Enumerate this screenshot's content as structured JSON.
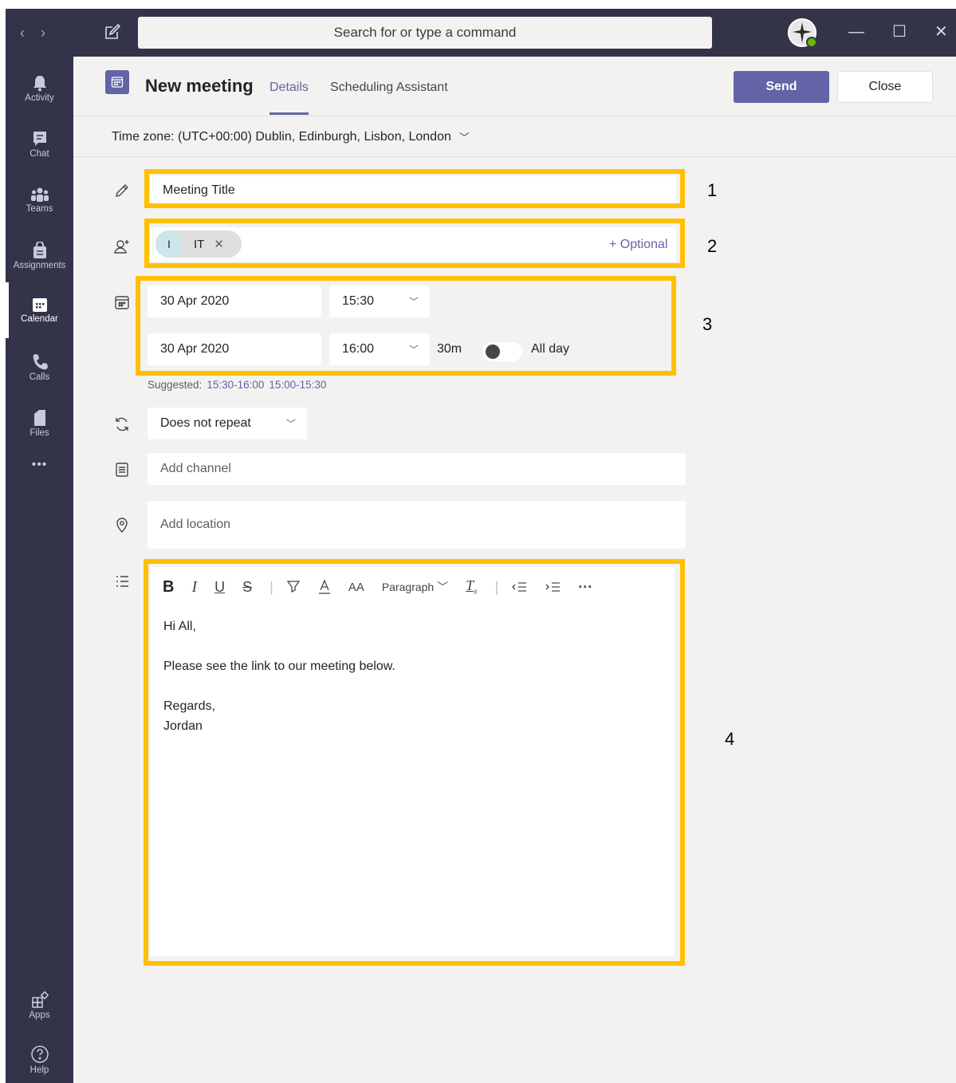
{
  "titlebar": {
    "back": "‹",
    "forward": "›",
    "search_placeholder": "Search for or type a command"
  },
  "appbar": [
    {
      "label": "Activity",
      "icon": "bell-icon"
    },
    {
      "label": "Chat",
      "icon": "chat-icon"
    },
    {
      "label": "Teams",
      "icon": "teams-icon"
    },
    {
      "label": "Assignments",
      "icon": "assignments-icon"
    },
    {
      "label": "Calendar",
      "icon": "calendar-icon"
    },
    {
      "label": "Calls",
      "icon": "phone-icon"
    },
    {
      "label": "Files",
      "icon": "file-icon"
    },
    {
      "label": "•••",
      "icon": "more-icon"
    }
  ],
  "appbar_bottom": [
    {
      "label": "Apps",
      "icon": "apps-icon"
    },
    {
      "label": "Help",
      "icon": "help-icon"
    }
  ],
  "header": {
    "title": "New meeting",
    "tabs": [
      "Details",
      "Scheduling Assistant"
    ],
    "send": "Send",
    "close": "Close"
  },
  "timezone": "Time zone: (UTC+00:00) Dublin, Edinburgh, Lisbon, London",
  "form": {
    "title_value": "Meeting Title",
    "attendee_initial": "I",
    "attendee_name": "IT",
    "optional": "+ Optional",
    "start_date": "30 Apr 2020",
    "start_time": "15:30",
    "end_date": "30 Apr 2020",
    "end_time": "16:00",
    "duration": "30m",
    "all_day": "All day",
    "suggested_label": "Suggested:",
    "suggested": [
      "15:30-16:00",
      "15:00-15:30"
    ],
    "repeat": "Does not repeat",
    "channel_placeholder": "Add channel",
    "location_placeholder": "Add location"
  },
  "editor": {
    "toolbar": {
      "bold": "B",
      "italic": "I",
      "underline": "U",
      "strike": "S",
      "font_size": "AA",
      "paragraph": "Paragraph",
      "clear": "T"
    },
    "lines": [
      "Hi All,",
      "",
      "Please see the link to our meeting below.",
      "",
      "Regards,",
      "Jordan"
    ]
  },
  "annotations": [
    "1",
    "2",
    "3",
    "4"
  ],
  "colors": {
    "accent": "#6264a7",
    "highlight": "#ffc000",
    "rail": "#33344a"
  }
}
